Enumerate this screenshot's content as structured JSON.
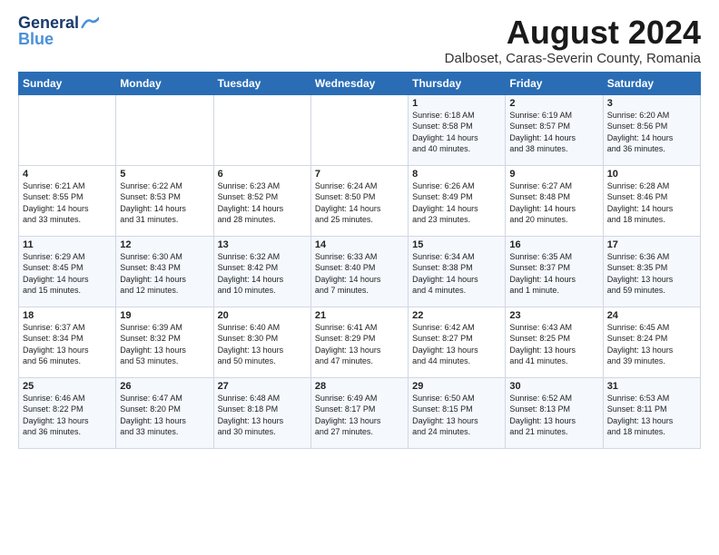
{
  "logo": {
    "general": "General",
    "blue": "Blue"
  },
  "title": {
    "month_year": "August 2024",
    "location": "Dalboset, Caras-Severin County, Romania"
  },
  "headers": [
    "Sunday",
    "Monday",
    "Tuesday",
    "Wednesday",
    "Thursday",
    "Friday",
    "Saturday"
  ],
  "weeks": [
    [
      {
        "day": "",
        "info": ""
      },
      {
        "day": "",
        "info": ""
      },
      {
        "day": "",
        "info": ""
      },
      {
        "day": "",
        "info": ""
      },
      {
        "day": "1",
        "info": "Sunrise: 6:18 AM\nSunset: 8:58 PM\nDaylight: 14 hours\nand 40 minutes."
      },
      {
        "day": "2",
        "info": "Sunrise: 6:19 AM\nSunset: 8:57 PM\nDaylight: 14 hours\nand 38 minutes."
      },
      {
        "day": "3",
        "info": "Sunrise: 6:20 AM\nSunset: 8:56 PM\nDaylight: 14 hours\nand 36 minutes."
      }
    ],
    [
      {
        "day": "4",
        "info": "Sunrise: 6:21 AM\nSunset: 8:55 PM\nDaylight: 14 hours\nand 33 minutes."
      },
      {
        "day": "5",
        "info": "Sunrise: 6:22 AM\nSunset: 8:53 PM\nDaylight: 14 hours\nand 31 minutes."
      },
      {
        "day": "6",
        "info": "Sunrise: 6:23 AM\nSunset: 8:52 PM\nDaylight: 14 hours\nand 28 minutes."
      },
      {
        "day": "7",
        "info": "Sunrise: 6:24 AM\nSunset: 8:50 PM\nDaylight: 14 hours\nand 25 minutes."
      },
      {
        "day": "8",
        "info": "Sunrise: 6:26 AM\nSunset: 8:49 PM\nDaylight: 14 hours\nand 23 minutes."
      },
      {
        "day": "9",
        "info": "Sunrise: 6:27 AM\nSunset: 8:48 PM\nDaylight: 14 hours\nand 20 minutes."
      },
      {
        "day": "10",
        "info": "Sunrise: 6:28 AM\nSunset: 8:46 PM\nDaylight: 14 hours\nand 18 minutes."
      }
    ],
    [
      {
        "day": "11",
        "info": "Sunrise: 6:29 AM\nSunset: 8:45 PM\nDaylight: 14 hours\nand 15 minutes."
      },
      {
        "day": "12",
        "info": "Sunrise: 6:30 AM\nSunset: 8:43 PM\nDaylight: 14 hours\nand 12 minutes."
      },
      {
        "day": "13",
        "info": "Sunrise: 6:32 AM\nSunset: 8:42 PM\nDaylight: 14 hours\nand 10 minutes."
      },
      {
        "day": "14",
        "info": "Sunrise: 6:33 AM\nSunset: 8:40 PM\nDaylight: 14 hours\nand 7 minutes."
      },
      {
        "day": "15",
        "info": "Sunrise: 6:34 AM\nSunset: 8:38 PM\nDaylight: 14 hours\nand 4 minutes."
      },
      {
        "day": "16",
        "info": "Sunrise: 6:35 AM\nSunset: 8:37 PM\nDaylight: 14 hours\nand 1 minute."
      },
      {
        "day": "17",
        "info": "Sunrise: 6:36 AM\nSunset: 8:35 PM\nDaylight: 13 hours\nand 59 minutes."
      }
    ],
    [
      {
        "day": "18",
        "info": "Sunrise: 6:37 AM\nSunset: 8:34 PM\nDaylight: 13 hours\nand 56 minutes."
      },
      {
        "day": "19",
        "info": "Sunrise: 6:39 AM\nSunset: 8:32 PM\nDaylight: 13 hours\nand 53 minutes."
      },
      {
        "day": "20",
        "info": "Sunrise: 6:40 AM\nSunset: 8:30 PM\nDaylight: 13 hours\nand 50 minutes."
      },
      {
        "day": "21",
        "info": "Sunrise: 6:41 AM\nSunset: 8:29 PM\nDaylight: 13 hours\nand 47 minutes."
      },
      {
        "day": "22",
        "info": "Sunrise: 6:42 AM\nSunset: 8:27 PM\nDaylight: 13 hours\nand 44 minutes."
      },
      {
        "day": "23",
        "info": "Sunrise: 6:43 AM\nSunset: 8:25 PM\nDaylight: 13 hours\nand 41 minutes."
      },
      {
        "day": "24",
        "info": "Sunrise: 6:45 AM\nSunset: 8:24 PM\nDaylight: 13 hours\nand 39 minutes."
      }
    ],
    [
      {
        "day": "25",
        "info": "Sunrise: 6:46 AM\nSunset: 8:22 PM\nDaylight: 13 hours\nand 36 minutes."
      },
      {
        "day": "26",
        "info": "Sunrise: 6:47 AM\nSunset: 8:20 PM\nDaylight: 13 hours\nand 33 minutes."
      },
      {
        "day": "27",
        "info": "Sunrise: 6:48 AM\nSunset: 8:18 PM\nDaylight: 13 hours\nand 30 minutes."
      },
      {
        "day": "28",
        "info": "Sunrise: 6:49 AM\nSunset: 8:17 PM\nDaylight: 13 hours\nand 27 minutes."
      },
      {
        "day": "29",
        "info": "Sunrise: 6:50 AM\nSunset: 8:15 PM\nDaylight: 13 hours\nand 24 minutes."
      },
      {
        "day": "30",
        "info": "Sunrise: 6:52 AM\nSunset: 8:13 PM\nDaylight: 13 hours\nand 21 minutes."
      },
      {
        "day": "31",
        "info": "Sunrise: 6:53 AM\nSunset: 8:11 PM\nDaylight: 13 hours\nand 18 minutes."
      }
    ]
  ]
}
